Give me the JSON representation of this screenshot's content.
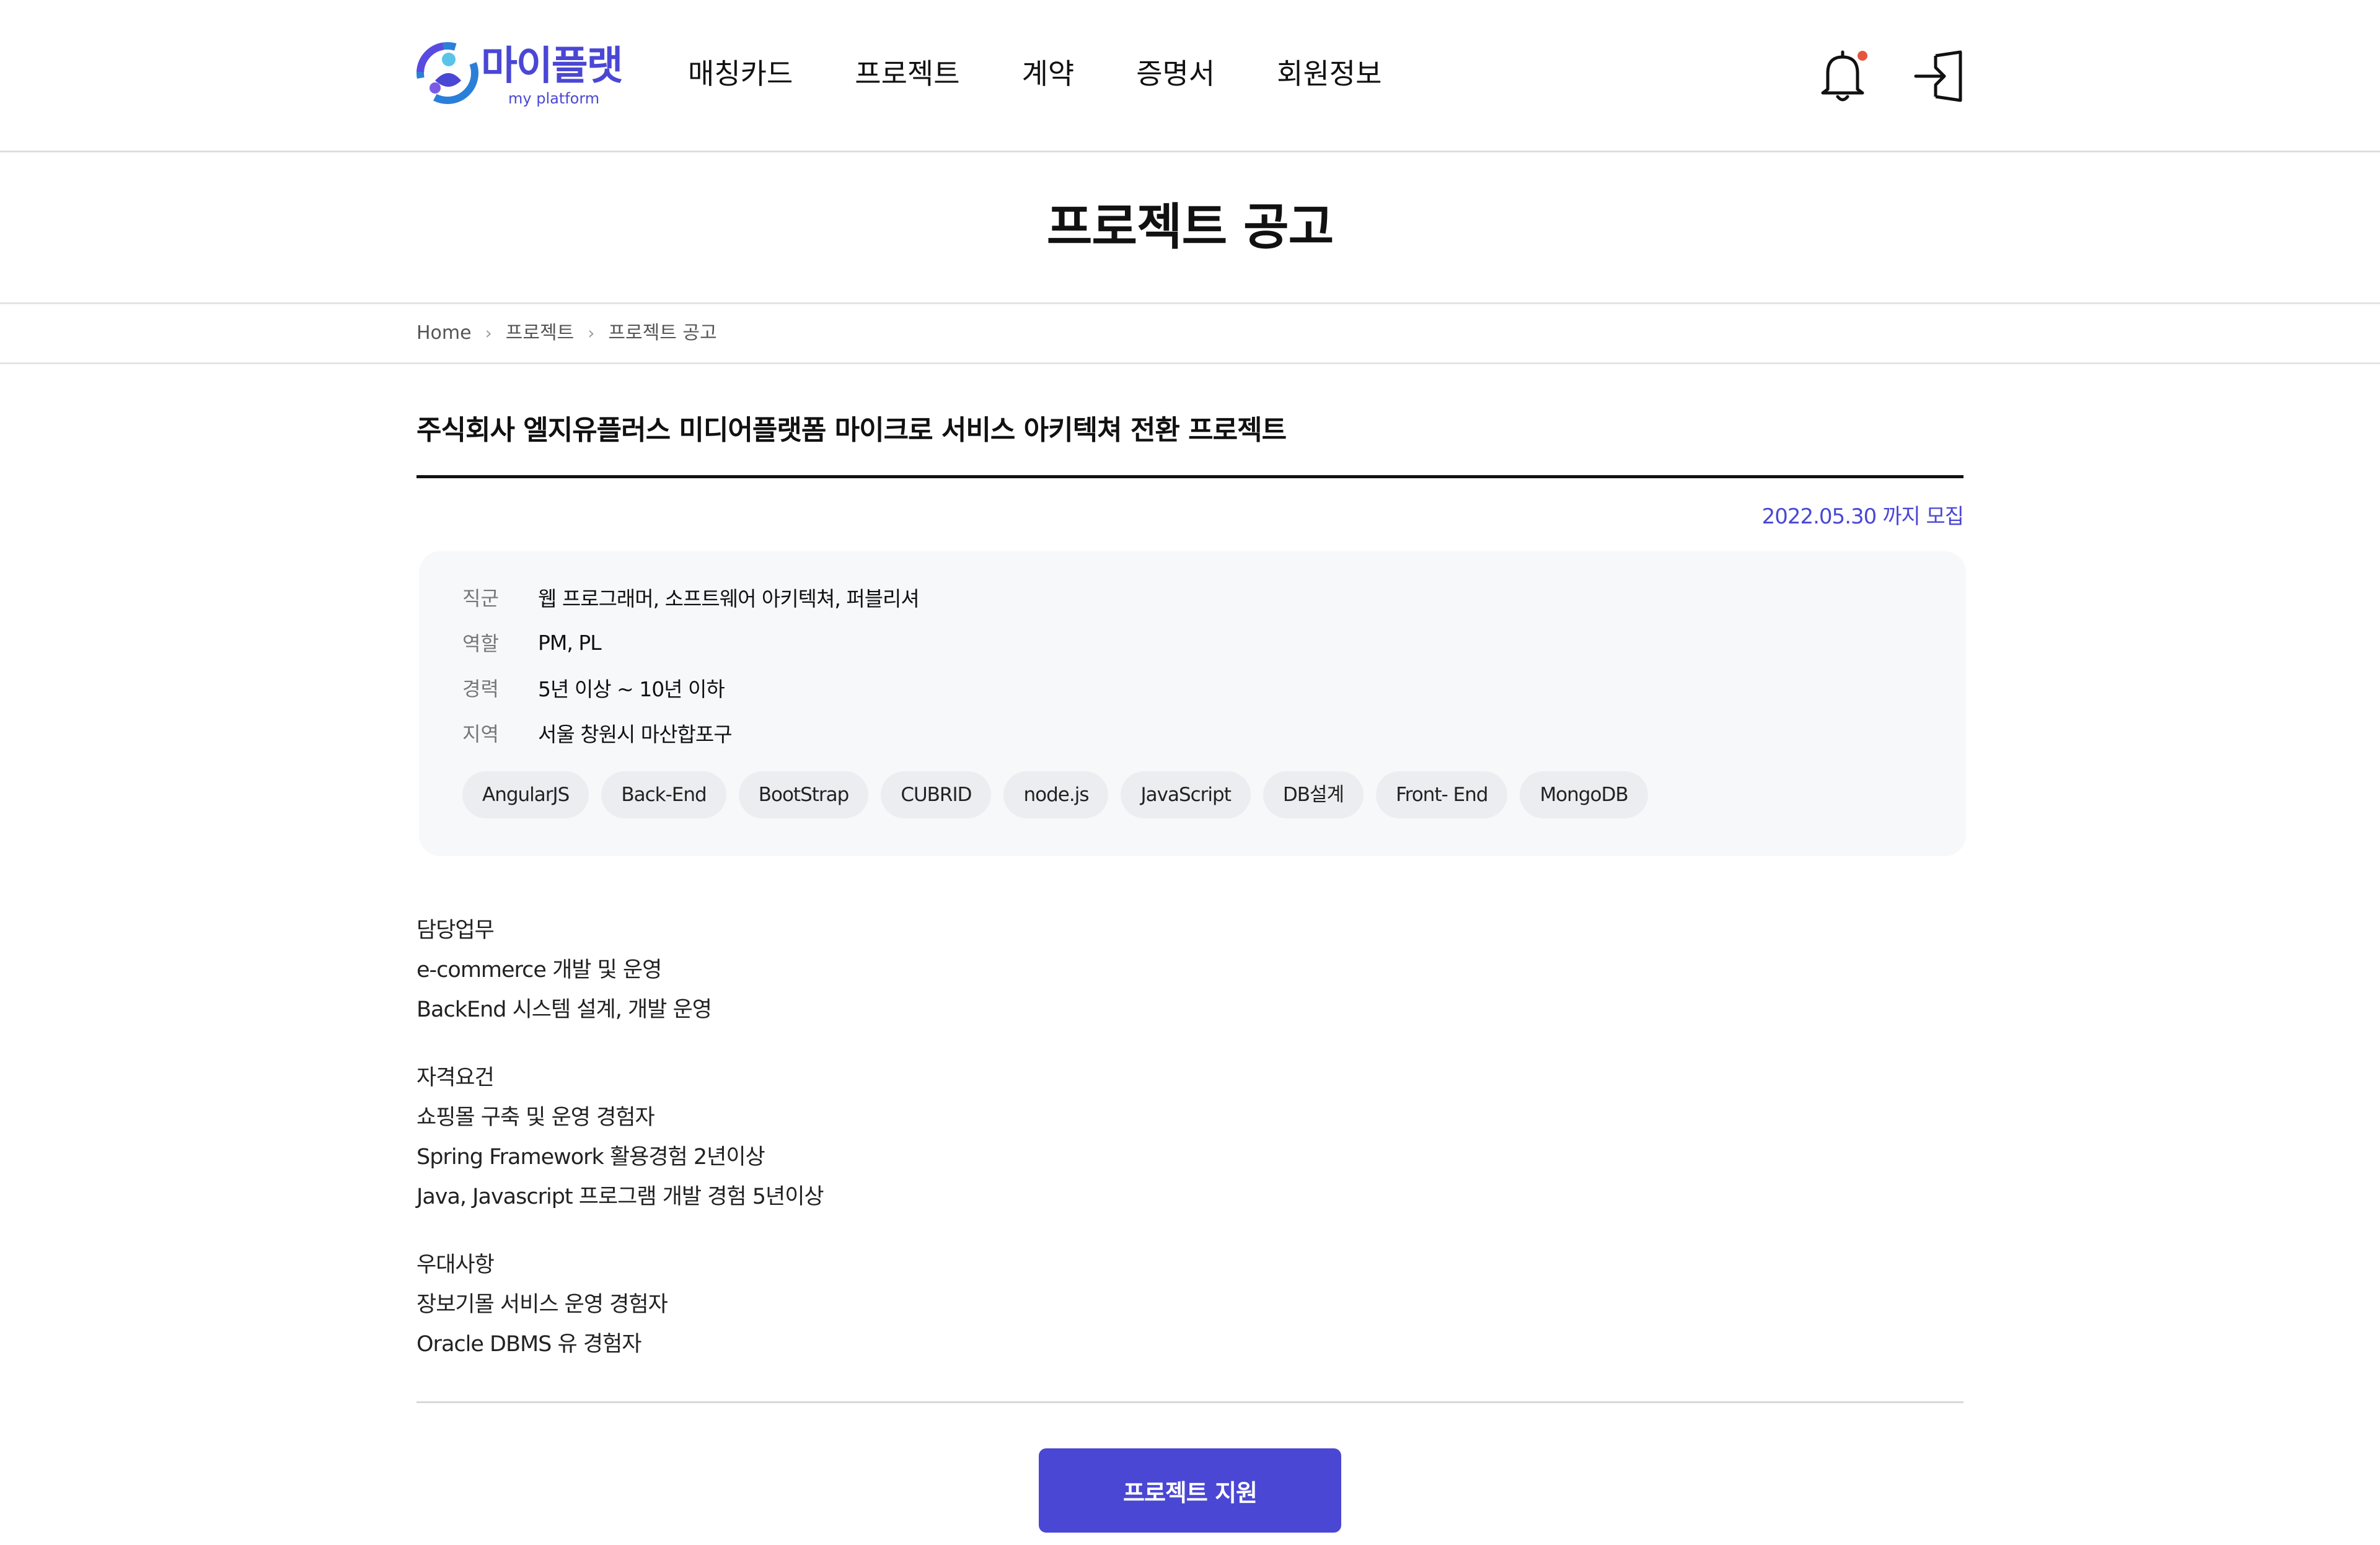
{
  "header": {
    "logo": {
      "title": "마이플랫",
      "subtitle": "my platform"
    },
    "nav": [
      "매칭카드",
      "프로젝트",
      "계약",
      "증명서",
      "회원정보"
    ],
    "icons": {
      "notification": "bell-icon",
      "login": "login-icon"
    },
    "notification_dot_color": "#e8553e"
  },
  "page_title": "프로젝트 공고",
  "breadcrumb": [
    "Home",
    "프로젝트",
    "프로젝트 공고"
  ],
  "post": {
    "title": "주식회사 엘지유플러스 미디어플랫폼 마이크로 서비스 아키텍쳐 전환 프로젝트",
    "deadline": "2022.05.30 까지 모집",
    "info": [
      {
        "label": "직군",
        "value": "웹 프로그래머, 소프트웨어 아키텍쳐, 퍼블리셔"
      },
      {
        "label": "역할",
        "value": "PM, PL"
      },
      {
        "label": "경력",
        "value": "5년 이상 ~ 10년 이하"
      },
      {
        "label": "지역",
        "value": "서울 창원시 마산합포구"
      }
    ],
    "tags": [
      "AngularJS",
      "Back-End",
      "BootStrap",
      "CUBRID",
      "node.js",
      "JavaScript",
      "DB설계",
      "Front- End",
      "MongoDB"
    ],
    "sections": [
      {
        "heading": "담당업무",
        "lines": [
          "e-commerce 개발 및 운영",
          "BackEnd 시스템 설계, 개발 운영"
        ]
      },
      {
        "heading": "자격요건",
        "lines": [
          "쇼핑몰 구축 및 운영 경험자",
          "Spring Framework 활용경험 2년이상",
          "Java, Javascript 프로그램 개발 경험 5년이상"
        ]
      },
      {
        "heading": "우대사항",
        "lines": [
          "장보기몰 서비스 운영 경험자",
          "Oracle DBMS 유 경험자"
        ]
      }
    ]
  },
  "apply_button": "프로젝트 지원",
  "colors": {
    "accent": "#4a47d4",
    "info_bg": "#f7f8fa",
    "tag_bg": "#ebedf0"
  }
}
